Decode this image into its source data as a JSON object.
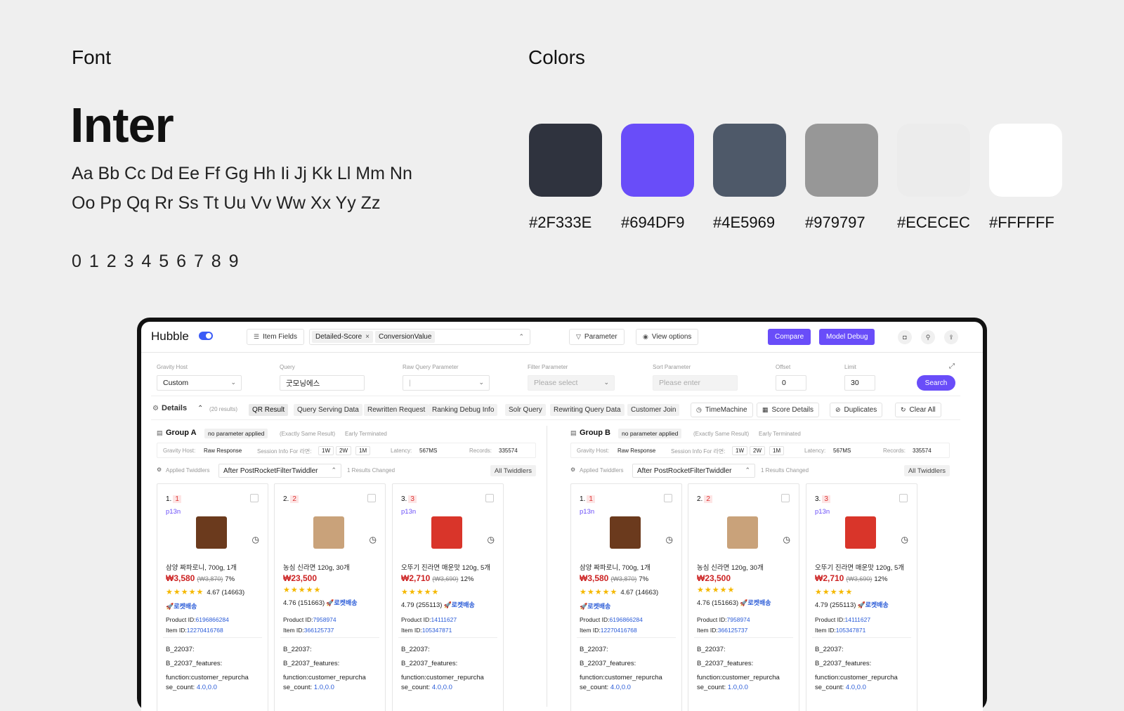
{
  "style_guide": {
    "font_heading": "Font",
    "font_name": "Inter",
    "alphabet_line1": "Aa Bb Cc Dd Ee Ff Gg Hh Ii Jj Kk Ll Mm Nn",
    "alphabet_line2": "Oo Pp Qq Rr Ss Tt Uu Vv Ww Xx Yy Zz",
    "digits": "0 1 2 3 4 5 6 7 8 9",
    "colors_heading": "Colors",
    "colors": [
      "#2F333E",
      "#694DF9",
      "#4E5969",
      "#979797",
      "#ECECEC",
      "#FFFFFF"
    ]
  },
  "app": {
    "logo": "Hubble",
    "toolbar": {
      "item_fields": "Item Fields",
      "tag1": "Detailed-Score",
      "tag2": "ConversionValue",
      "parameter": "Parameter",
      "view_options": "View options",
      "compare": "Compare",
      "model_debug": "Model Debug"
    },
    "params": {
      "gravity_host_label": "Gravity Host",
      "gravity_host_value": "Custom",
      "query_label": "Query",
      "query_value": "굿모닝에스",
      "raw_query_label": "Raw Query Parameter",
      "raw_query_value": "|",
      "filter_label": "Filter Parameter",
      "filter_placeholder": "Please select",
      "sort_label": "Sort Parameter",
      "sort_placeholder": "Please enter",
      "offset_label": "Offset",
      "offset_value": "0",
      "limit_label": "Limit",
      "limit_value": "30",
      "search": "Search"
    },
    "details": {
      "title": "Details",
      "results": "(20 results)",
      "tabs": [
        "QR Result",
        "Query Serving Data",
        "Rewritten Request",
        "Ranking Debug Info",
        "Solr Query",
        "Rewriting Query Data",
        "Customer Join"
      ],
      "time_machine": "TimeMachine",
      "score_details": "Score Details",
      "duplicates": "Duplicates",
      "clear_all": "Clear All"
    },
    "group_common": {
      "no_param": "no parameter applied",
      "exact": "(Exactly Same Result)",
      "early": "Early Terminated",
      "gravity_host_label": "Gravity Host:",
      "gravity_host_value": "Raw Response",
      "session_label": "Session Info For 라면:",
      "w1": "1W",
      "w2": "2W",
      "m1": "1M",
      "latency_label": "Latency:",
      "latency_value": "567MS",
      "records_label": "Records:",
      "records_value": "335574",
      "applied_label": "Applied Twiddlers",
      "twiddler": "After PostRocketFilterTwiddler",
      "changed": "1 Results Changed",
      "all_twiddlers": "All Twiddlers"
    },
    "groups": [
      {
        "title": "Group A"
      },
      {
        "title": "Group B"
      }
    ],
    "products": [
      {
        "num": "1.",
        "rank": "1",
        "tag": "p13n",
        "name": "삼양 짜파로니, 700g, 1개",
        "price": "₩3,580",
        "orig": "(₩3,870)",
        "disc": "7%",
        "stars": "★★★★★",
        "rating": "4.67 (14663)",
        "rocket": "🚀로켓배송",
        "pid_label": "Product ID:",
        "pid": "6196866284",
        "iid_label": "Item ID:",
        "iid": "12270416768",
        "f1": "B_22037:",
        "f2": "B_22037_features:",
        "f3": "function:customer_repurcha",
        "f4a": "se_count: ",
        "f4b": "4.0,0.0",
        "thumb": "#6b3a1d"
      },
      {
        "num": "2.",
        "rank": "2",
        "tag": "",
        "name": "농심 신라면 120g, 30개",
        "price": "₩23,500",
        "orig": "",
        "disc": "",
        "stars": "★★★★★",
        "rating": "4.76 (151663)",
        "rocket": "🚀로켓배송",
        "pid_label": "Product ID:",
        "pid": "7958974",
        "iid_label": "Item ID:",
        "iid": "366125737",
        "f1": "B_22037:",
        "f2": "B_22037_features:",
        "f3": "function:customer_repurcha",
        "f4a": "se_count: ",
        "f4b": "1.0,0.0",
        "thumb": "#c9a27a"
      },
      {
        "num": "3.",
        "rank": "3",
        "tag": "p13n",
        "name": "오뚜기 진라면 매운맛 120g, 5개",
        "price": "₩2,710",
        "orig": "(₩3,690)",
        "disc": "12%",
        "stars": "★★★★★",
        "rating": "4.79 (255113)",
        "rocket": "🚀로켓배송",
        "pid_label": "Product ID:",
        "pid": "14111627",
        "iid_label": "Item ID:",
        "iid": "105347871",
        "f1": "B_22037:",
        "f2": "B_22037_features:",
        "f3": "function:customer_repurcha",
        "f4a": "se_count: ",
        "f4b": "4.0,0.0",
        "thumb": "#d9352a"
      }
    ]
  }
}
